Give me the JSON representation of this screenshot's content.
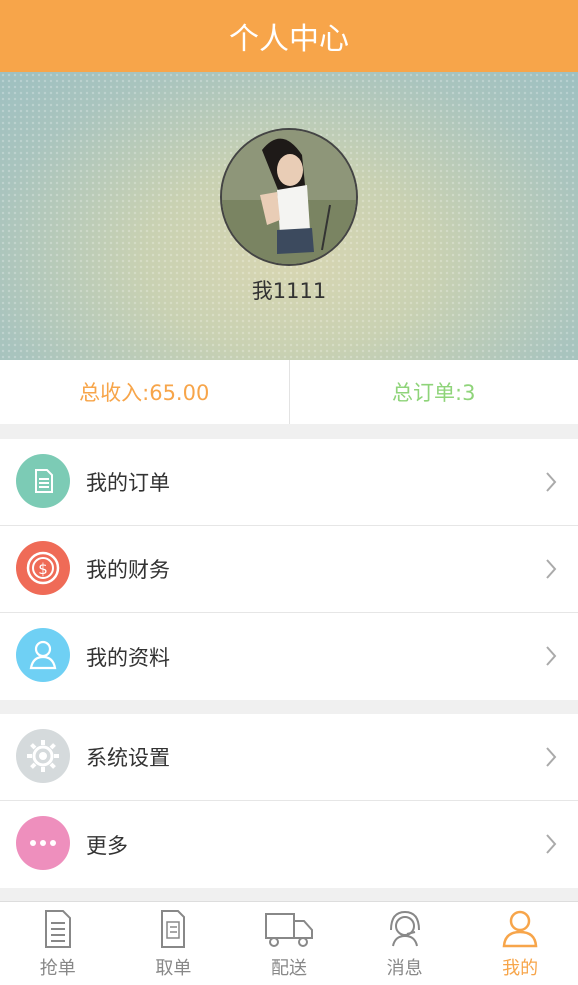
{
  "header": {
    "title": "个人中心"
  },
  "profile": {
    "username": "我1111"
  },
  "stats": {
    "income": "总收入:65.00",
    "orders": "总订单:3"
  },
  "menu_group1": [
    {
      "label": "我的订单",
      "icon": "order-document-icon",
      "color": "#7ccbb5"
    },
    {
      "label": "我的财务",
      "icon": "dollar-coin-icon",
      "color": "#ef6b57"
    },
    {
      "label": "我的资料",
      "icon": "person-icon",
      "color": "#6fd0f4"
    }
  ],
  "menu_group2": [
    {
      "label": "系统设置",
      "icon": "gear-icon",
      "color": "#d5dadc"
    },
    {
      "label": "更多",
      "icon": "more-dots-icon",
      "color": "#ee8fbd"
    }
  ],
  "tabbar": [
    {
      "label": "抢单",
      "icon": "document-icon"
    },
    {
      "label": "取单",
      "icon": "receipt-icon"
    },
    {
      "label": "配送",
      "icon": "truck-icon"
    },
    {
      "label": "消息",
      "icon": "headset-icon"
    },
    {
      "label": "我的",
      "icon": "user-icon",
      "active": true
    }
  ],
  "colors": {
    "accent": "#f7a54a",
    "orders_green": "#8fd47a"
  }
}
